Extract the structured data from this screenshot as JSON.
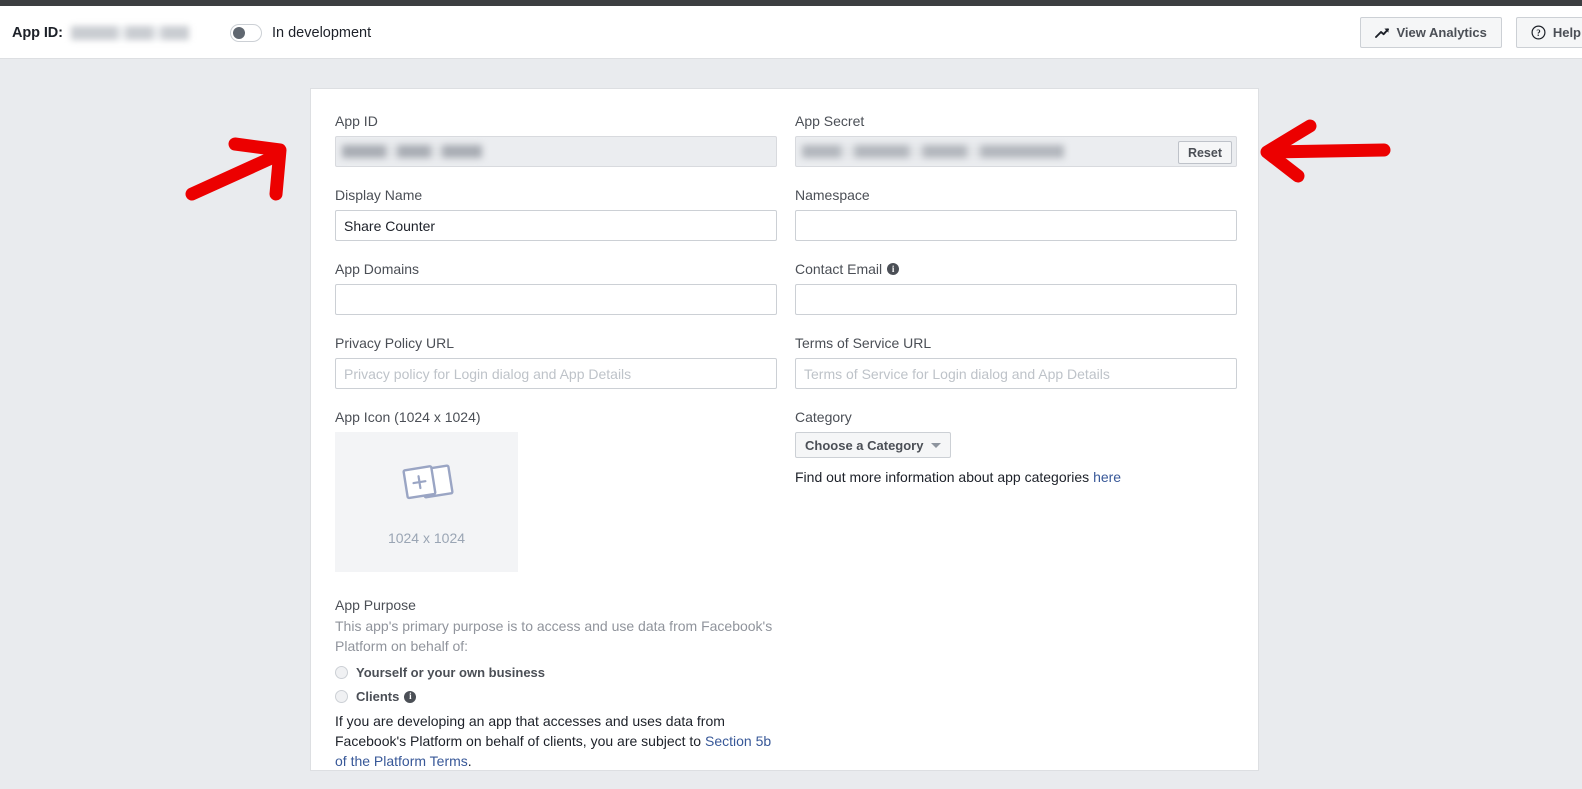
{
  "header": {
    "app_id_label": "App ID:",
    "app_id_value_redacted": "",
    "mode_toggle_label": "In development",
    "mode_toggle_state": "off",
    "view_analytics_label": "View Analytics",
    "help_label": "Help"
  },
  "form": {
    "app_id": {
      "label": "App ID",
      "value_redacted": "",
      "readonly": true
    },
    "app_secret": {
      "label": "App Secret",
      "value_redacted": "",
      "reset_label": "Reset",
      "readonly": true
    },
    "display_name": {
      "label": "Display Name",
      "value": "Share Counter",
      "placeholder": ""
    },
    "namespace": {
      "label": "Namespace",
      "value": "",
      "placeholder": ""
    },
    "app_domains": {
      "label": "App Domains",
      "value": "",
      "placeholder": ""
    },
    "contact_email": {
      "label": "Contact Email",
      "value_redacted": "",
      "info_glyph": "i"
    },
    "privacy_policy_url": {
      "label": "Privacy Policy URL",
      "value": "",
      "placeholder": "Privacy policy for Login dialog and App Details"
    },
    "terms_of_service_url": {
      "label": "Terms of Service URL",
      "value": "",
      "placeholder": "Terms of Service for Login dialog and App Details"
    },
    "app_icon": {
      "label": "App Icon (1024 x 1024)",
      "placeholder_size": "1024 x 1024"
    },
    "category": {
      "label": "Category",
      "selected": "Choose a Category",
      "help_prefix": "Find out more information about app categories ",
      "help_link": "here"
    },
    "app_purpose": {
      "title": "App Purpose",
      "subtitle": "This app's primary purpose is to access and use data from Facebook's Platform on behalf of:",
      "options": [
        {
          "label": "Yourself or your own business",
          "selected": false
        },
        {
          "label": "Clients",
          "selected": false,
          "info_glyph": "i"
        }
      ],
      "note_prefix": "If you are developing an app that accesses and uses data from Facebook's Platform on behalf of clients, you are subject to ",
      "note_link": "Section 5b of the Platform Terms",
      "note_suffix": "."
    }
  },
  "annotations": {
    "left_arrow": "red-arrow-pointing-up-right-at-app-id-field",
    "right_arrow": "red-arrow-pointing-left-at-app-secret-reset"
  },
  "colors": {
    "page_background": "#e9ebee",
    "card_background": "#ffffff",
    "top_strip": "#3c3e41",
    "link": "#385898",
    "annotation_red": "#ec0000",
    "label_text": "#4b4f56",
    "muted_text": "#90949c"
  }
}
